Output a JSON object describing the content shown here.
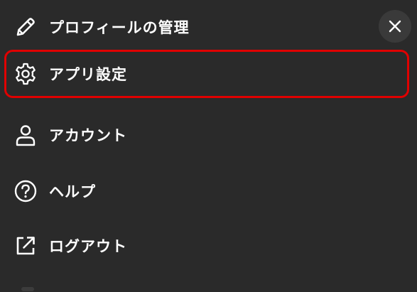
{
  "menu": {
    "close_icon": "close-icon",
    "items": [
      {
        "label": "プロフィールの管理",
        "icon": "pencil-icon"
      },
      {
        "label": "アプリ設定",
        "icon": "gear-icon"
      },
      {
        "label": "アカウント",
        "icon": "person-icon"
      },
      {
        "label": "ヘルプ",
        "icon": "help-circle-icon"
      },
      {
        "label": "ログアウト",
        "icon": "external-link-icon"
      }
    ]
  },
  "colors": {
    "panel_background": "#2a2a2a",
    "text": "#ffffff",
    "highlight_border": "#e00000",
    "close_button_background": "#3a3a3a"
  }
}
